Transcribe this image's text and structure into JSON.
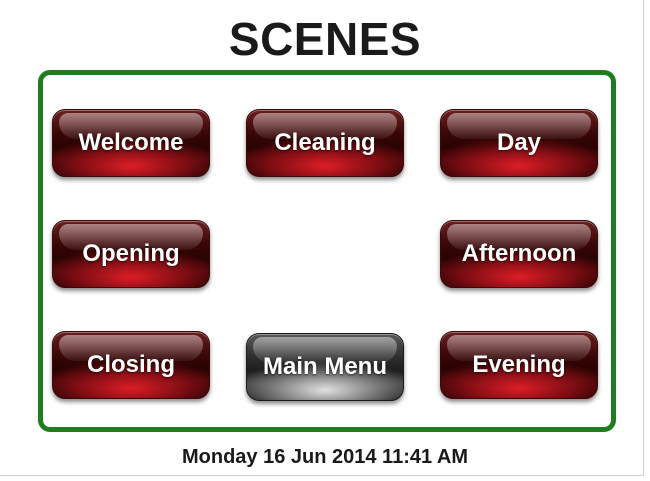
{
  "page": {
    "title": "SCENES",
    "datetime": "Monday 16 Jun 2014 11:41 AM"
  },
  "colors": {
    "panel_border": "#1e7d1e",
    "scene_button": "#8b0f14",
    "menu_button": "#2e2e2e",
    "button_text": "#ffffff"
  },
  "scenes": {
    "welcome": "Welcome",
    "cleaning": "Cleaning",
    "day": "Day",
    "opening": "Opening",
    "afternoon": "Afternoon",
    "closing": "Closing",
    "evening": "Evening"
  },
  "menu": {
    "main_menu": "Main Menu"
  }
}
